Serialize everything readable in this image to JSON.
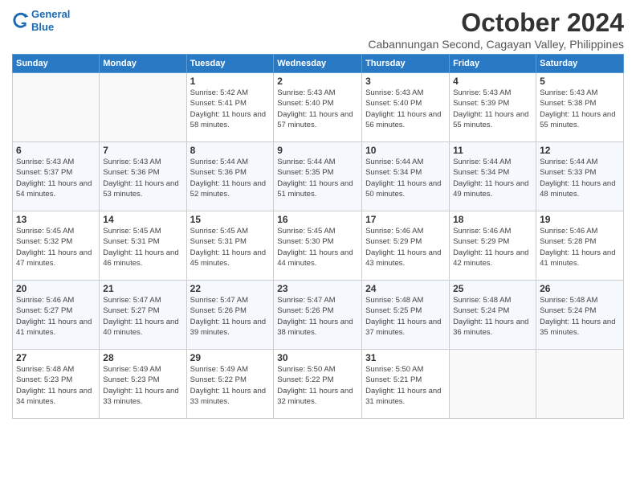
{
  "logo": {
    "line1": "General",
    "line2": "Blue"
  },
  "title": "October 2024",
  "subtitle": "Cabannungan Second, Cagayan Valley, Philippines",
  "days_header": [
    "Sunday",
    "Monday",
    "Tuesday",
    "Wednesday",
    "Thursday",
    "Friday",
    "Saturday"
  ],
  "weeks": [
    [
      {
        "day": "",
        "info": ""
      },
      {
        "day": "",
        "info": ""
      },
      {
        "day": "1",
        "info": "Sunrise: 5:42 AM\nSunset: 5:41 PM\nDaylight: 11 hours and 58 minutes."
      },
      {
        "day": "2",
        "info": "Sunrise: 5:43 AM\nSunset: 5:40 PM\nDaylight: 11 hours and 57 minutes."
      },
      {
        "day": "3",
        "info": "Sunrise: 5:43 AM\nSunset: 5:40 PM\nDaylight: 11 hours and 56 minutes."
      },
      {
        "day": "4",
        "info": "Sunrise: 5:43 AM\nSunset: 5:39 PM\nDaylight: 11 hours and 55 minutes."
      },
      {
        "day": "5",
        "info": "Sunrise: 5:43 AM\nSunset: 5:38 PM\nDaylight: 11 hours and 55 minutes."
      }
    ],
    [
      {
        "day": "6",
        "info": "Sunrise: 5:43 AM\nSunset: 5:37 PM\nDaylight: 11 hours and 54 minutes."
      },
      {
        "day": "7",
        "info": "Sunrise: 5:43 AM\nSunset: 5:36 PM\nDaylight: 11 hours and 53 minutes."
      },
      {
        "day": "8",
        "info": "Sunrise: 5:44 AM\nSunset: 5:36 PM\nDaylight: 11 hours and 52 minutes."
      },
      {
        "day": "9",
        "info": "Sunrise: 5:44 AM\nSunset: 5:35 PM\nDaylight: 11 hours and 51 minutes."
      },
      {
        "day": "10",
        "info": "Sunrise: 5:44 AM\nSunset: 5:34 PM\nDaylight: 11 hours and 50 minutes."
      },
      {
        "day": "11",
        "info": "Sunrise: 5:44 AM\nSunset: 5:34 PM\nDaylight: 11 hours and 49 minutes."
      },
      {
        "day": "12",
        "info": "Sunrise: 5:44 AM\nSunset: 5:33 PM\nDaylight: 11 hours and 48 minutes."
      }
    ],
    [
      {
        "day": "13",
        "info": "Sunrise: 5:45 AM\nSunset: 5:32 PM\nDaylight: 11 hours and 47 minutes."
      },
      {
        "day": "14",
        "info": "Sunrise: 5:45 AM\nSunset: 5:31 PM\nDaylight: 11 hours and 46 minutes."
      },
      {
        "day": "15",
        "info": "Sunrise: 5:45 AM\nSunset: 5:31 PM\nDaylight: 11 hours and 45 minutes."
      },
      {
        "day": "16",
        "info": "Sunrise: 5:45 AM\nSunset: 5:30 PM\nDaylight: 11 hours and 44 minutes."
      },
      {
        "day": "17",
        "info": "Sunrise: 5:46 AM\nSunset: 5:29 PM\nDaylight: 11 hours and 43 minutes."
      },
      {
        "day": "18",
        "info": "Sunrise: 5:46 AM\nSunset: 5:29 PM\nDaylight: 11 hours and 42 minutes."
      },
      {
        "day": "19",
        "info": "Sunrise: 5:46 AM\nSunset: 5:28 PM\nDaylight: 11 hours and 41 minutes."
      }
    ],
    [
      {
        "day": "20",
        "info": "Sunrise: 5:46 AM\nSunset: 5:27 PM\nDaylight: 11 hours and 41 minutes."
      },
      {
        "day": "21",
        "info": "Sunrise: 5:47 AM\nSunset: 5:27 PM\nDaylight: 11 hours and 40 minutes."
      },
      {
        "day": "22",
        "info": "Sunrise: 5:47 AM\nSunset: 5:26 PM\nDaylight: 11 hours and 39 minutes."
      },
      {
        "day": "23",
        "info": "Sunrise: 5:47 AM\nSunset: 5:26 PM\nDaylight: 11 hours and 38 minutes."
      },
      {
        "day": "24",
        "info": "Sunrise: 5:48 AM\nSunset: 5:25 PM\nDaylight: 11 hours and 37 minutes."
      },
      {
        "day": "25",
        "info": "Sunrise: 5:48 AM\nSunset: 5:24 PM\nDaylight: 11 hours and 36 minutes."
      },
      {
        "day": "26",
        "info": "Sunrise: 5:48 AM\nSunset: 5:24 PM\nDaylight: 11 hours and 35 minutes."
      }
    ],
    [
      {
        "day": "27",
        "info": "Sunrise: 5:48 AM\nSunset: 5:23 PM\nDaylight: 11 hours and 34 minutes."
      },
      {
        "day": "28",
        "info": "Sunrise: 5:49 AM\nSunset: 5:23 PM\nDaylight: 11 hours and 33 minutes."
      },
      {
        "day": "29",
        "info": "Sunrise: 5:49 AM\nSunset: 5:22 PM\nDaylight: 11 hours and 33 minutes."
      },
      {
        "day": "30",
        "info": "Sunrise: 5:50 AM\nSunset: 5:22 PM\nDaylight: 11 hours and 32 minutes."
      },
      {
        "day": "31",
        "info": "Sunrise: 5:50 AM\nSunset: 5:21 PM\nDaylight: 11 hours and 31 minutes."
      },
      {
        "day": "",
        "info": ""
      },
      {
        "day": "",
        "info": ""
      }
    ]
  ]
}
